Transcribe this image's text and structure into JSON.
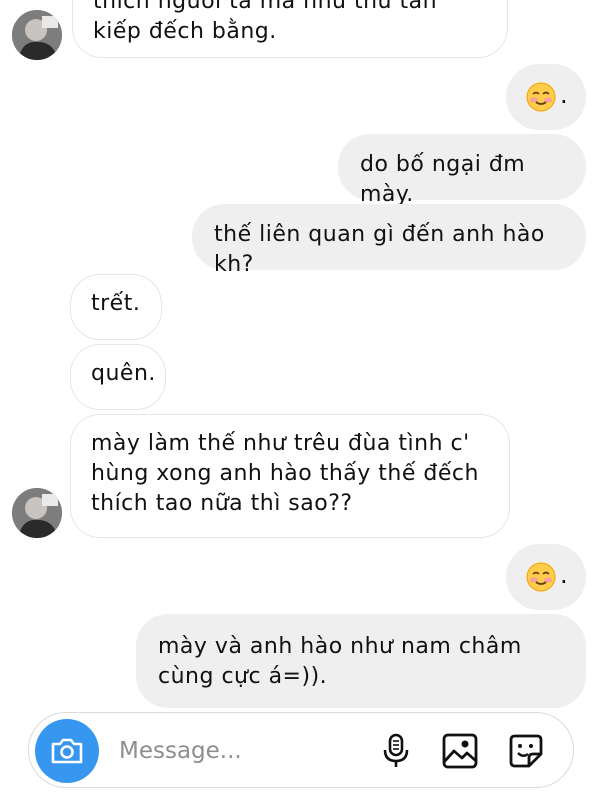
{
  "conversation": {
    "messages": [
      {
        "side": "incoming",
        "text": "thích người ta mà như thứ tàn kiếp đếch bằng."
      },
      {
        "side": "outgoing",
        "emoji": "blush-emoji",
        "text": "."
      },
      {
        "side": "outgoing",
        "text": "do bố ngại đm mày."
      },
      {
        "side": "outgoing",
        "text": "thế liên quan gì đến anh hào kh?"
      },
      {
        "side": "incoming",
        "text": "trết."
      },
      {
        "side": "incoming",
        "text": "quên."
      },
      {
        "side": "incoming",
        "text": "mày làm thế như trêu đùa tình c' hùng xong anh hào thấy thế đếch thích tao nữa thì sao??"
      },
      {
        "side": "outgoing",
        "emoji": "blush-emoji",
        "text": "."
      },
      {
        "side": "outgoing",
        "text": "mày và anh hào như nam châm cùng cực á=))."
      }
    ]
  },
  "composer": {
    "placeholder": "Message...",
    "icons": [
      "camera-icon",
      "microphone-icon",
      "gallery-icon",
      "sticker-icon"
    ]
  },
  "colors": {
    "camera_button": "#3797f0",
    "outgoing_bubble": "#efefef",
    "incoming_border": "#e6e6e6"
  }
}
